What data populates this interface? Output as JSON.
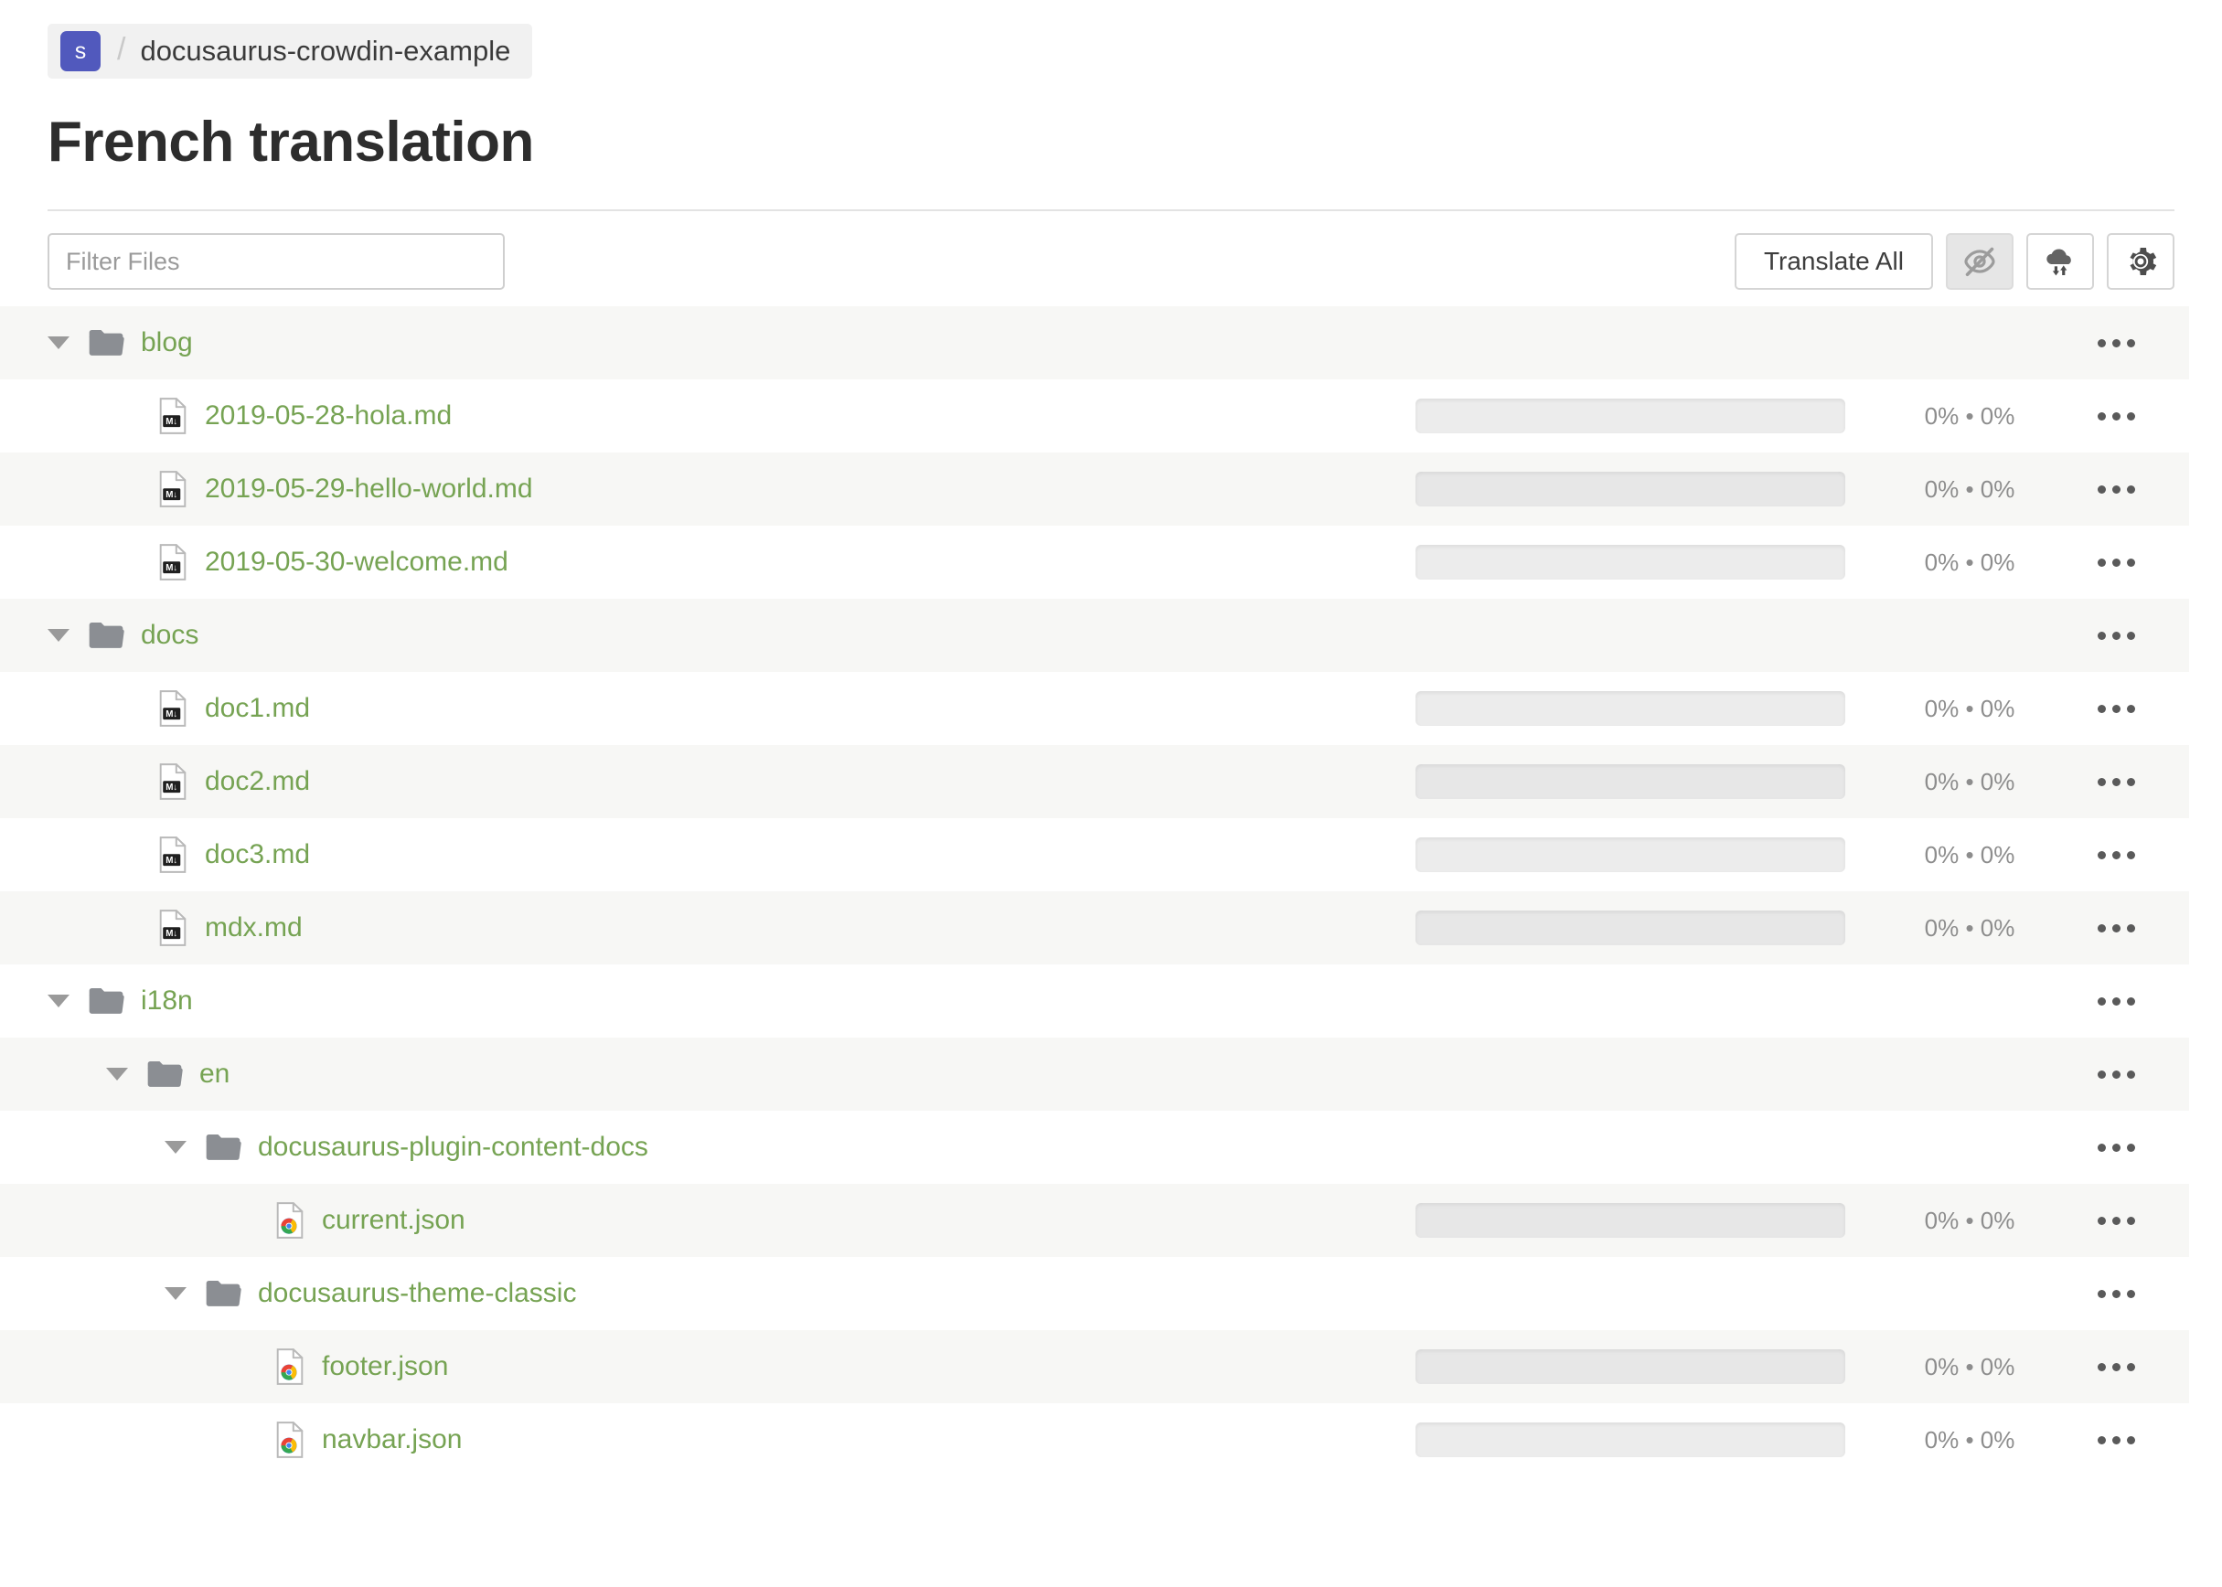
{
  "breadcrumb": {
    "avatar_initial": "s",
    "separator": "/",
    "project": "docusaurus-crowdin-example"
  },
  "header": {
    "title": "French translation"
  },
  "toolbar": {
    "filter_placeholder": "Filter Files",
    "filter_value": "",
    "translate_all_label": "Translate All",
    "hide_icon": "eye-off-icon",
    "sync_icon": "cloud-sync-icon",
    "settings_icon": "gear-icon"
  },
  "colors": {
    "accent_green": "#76a353",
    "avatar_purple": "#5159bd",
    "row_alt": "#f7f7f5",
    "progress_track": "#ececec"
  },
  "file_tree": {
    "progress_label": "0% • 0%",
    "menu_icon": "kebab-menu-icon",
    "rows": [
      {
        "type": "folder",
        "name": "blog",
        "depth": 0,
        "expanded": true,
        "alt": true
      },
      {
        "type": "md",
        "name": "2019-05-28-hola.md",
        "depth": 1,
        "progress": "0% • 0%",
        "alt": false
      },
      {
        "type": "md",
        "name": "2019-05-29-hello-world.md",
        "depth": 1,
        "progress": "0% • 0%",
        "alt": true
      },
      {
        "type": "md",
        "name": "2019-05-30-welcome.md",
        "depth": 1,
        "progress": "0% • 0%",
        "alt": false
      },
      {
        "type": "folder",
        "name": "docs",
        "depth": 0,
        "expanded": true,
        "alt": true
      },
      {
        "type": "md",
        "name": "doc1.md",
        "depth": 1,
        "progress": "0% • 0%",
        "alt": false
      },
      {
        "type": "md",
        "name": "doc2.md",
        "depth": 1,
        "progress": "0% • 0%",
        "alt": true
      },
      {
        "type": "md",
        "name": "doc3.md",
        "depth": 1,
        "progress": "0% • 0%",
        "alt": false
      },
      {
        "type": "md",
        "name": "mdx.md",
        "depth": 1,
        "progress": "0% • 0%",
        "alt": true
      },
      {
        "type": "folder",
        "name": "i18n",
        "depth": 0,
        "expanded": true,
        "alt": false
      },
      {
        "type": "folder",
        "name": "en",
        "depth": 1,
        "expanded": true,
        "alt": true
      },
      {
        "type": "folder",
        "name": "docusaurus-plugin-content-docs",
        "depth": 2,
        "expanded": true,
        "alt": false
      },
      {
        "type": "json",
        "name": "current.json",
        "depth": 3,
        "progress": "0% • 0%",
        "alt": true
      },
      {
        "type": "folder",
        "name": "docusaurus-theme-classic",
        "depth": 2,
        "expanded": true,
        "alt": false
      },
      {
        "type": "json",
        "name": "footer.json",
        "depth": 3,
        "progress": "0% • 0%",
        "alt": true
      },
      {
        "type": "json",
        "name": "navbar.json",
        "depth": 3,
        "progress": "0% • 0%",
        "alt": false
      }
    ]
  }
}
